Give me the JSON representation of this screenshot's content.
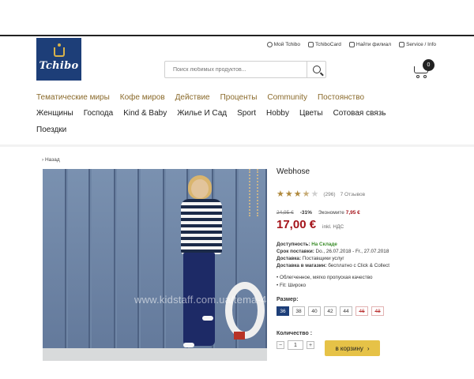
{
  "header": {
    "logo_text": "Tchibo",
    "utils": [
      {
        "label": "Мой Tchibo",
        "icon": "user-icon"
      },
      {
        "label": "TchiboCard",
        "icon": "card-icon"
      },
      {
        "label": "Найти филиал",
        "icon": "store-icon"
      },
      {
        "label": "Service / Info",
        "icon": "monitor-icon"
      }
    ],
    "search_placeholder": "Поиск любимых продуктов...",
    "cart_count": "0"
  },
  "nav": {
    "row1": [
      "Тематические миры",
      "Кофе миров",
      "Действие",
      "Проценты",
      "Community",
      "Постоянство"
    ],
    "row2": [
      "Женщины",
      "Господа",
      "Kind & Baby",
      "Жилье И Сад",
      "Sport",
      "Hobby",
      "Цветы",
      "Сотовая связь"
    ],
    "row3": [
      "Поездки"
    ]
  },
  "breadcrumb": {
    "back": "Назад"
  },
  "product": {
    "title": "Webhose",
    "rating": {
      "value": 3.5,
      "max": 5,
      "count": "(296)",
      "reviews_label": "7 Отзывов"
    },
    "old_price": "24,95 €",
    "discount": "-31%",
    "savings_label": "Экономите",
    "savings_value": "7,95 €",
    "price": "17,00 €",
    "vat": "inkl. НДС",
    "info": {
      "availability_label": "Доступность:",
      "availability_value": "На Складе",
      "delivery_time_label": "Срок поставки:",
      "delivery_time_value": "Do., 26.07.2018 - Fr., 27.07.2018",
      "delivery_label": "Доставка:",
      "delivery_value": "Поставщики услуг",
      "store_label": "Доставка в магазин:",
      "store_value": "бесплатно с Click & Collect"
    },
    "bullets": [
      "Облегченное, мягко пропуская качество",
      "Fit: Широко"
    ],
    "size_label": "Размер:",
    "sizes": [
      {
        "label": "36",
        "state": "active"
      },
      {
        "label": "38",
        "state": "normal"
      },
      {
        "label": "40",
        "state": "normal"
      },
      {
        "label": "42",
        "state": "normal"
      },
      {
        "label": "44",
        "state": "normal"
      },
      {
        "label": "46",
        "state": "unavailable"
      },
      {
        "label": "48",
        "state": "unavailable"
      }
    ],
    "qty_label": "Количество :",
    "qty_minus": "−",
    "qty_value": "1",
    "qty_plus": "+",
    "add_to_cart": "в корзину"
  },
  "watermark": "www.kidstaff.com.ua/tema-465752.html",
  "colors": {
    "brand_blue": "#1d3e78",
    "price_red": "#a4131a",
    "nav_gold": "#8a6a2b",
    "cart_button": "#e6c247"
  }
}
